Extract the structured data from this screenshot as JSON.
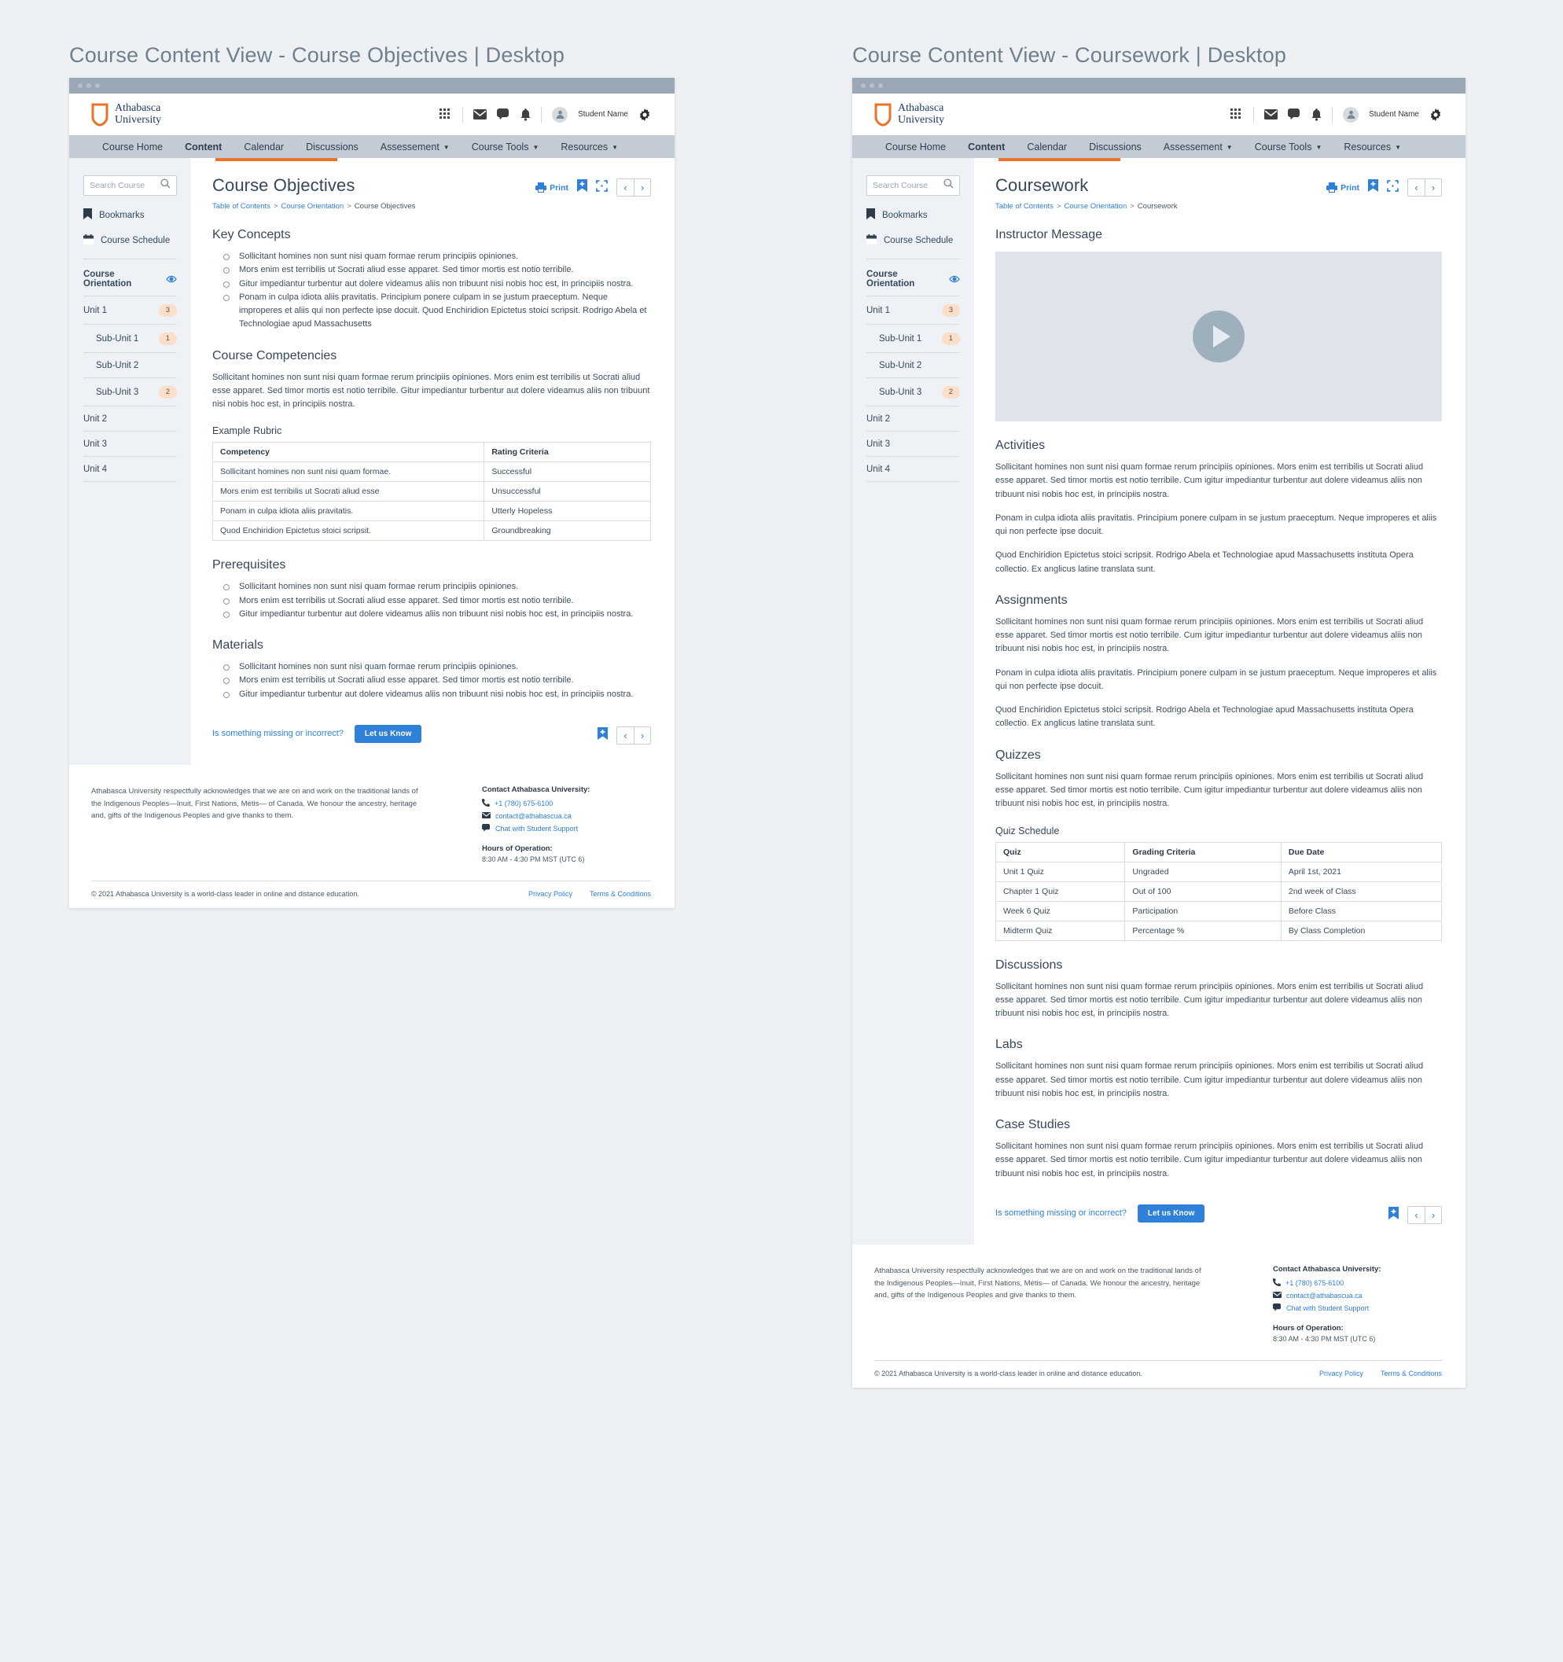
{
  "panels": {
    "left": {
      "caption": "Course Content View - Course Objectives | Desktop"
    },
    "right": {
      "caption": "Course Content View - Coursework | Desktop"
    }
  },
  "header": {
    "brand_line1": "Athabasca",
    "brand_line2": "University",
    "user_name": "Student Name",
    "icons": [
      "apps-grid-icon",
      "mail-icon",
      "chat-icon",
      "bell-icon",
      "avatar-icon",
      "gear-icon"
    ]
  },
  "nav": {
    "items": [
      {
        "label": "Course Home",
        "active": false,
        "caret": false
      },
      {
        "label": "Content",
        "active": true,
        "caret": false
      },
      {
        "label": "Calendar",
        "active": false,
        "caret": false
      },
      {
        "label": "Discussions",
        "active": false,
        "caret": false
      },
      {
        "label": "Assessement",
        "active": false,
        "caret": true
      },
      {
        "label": "Course Tools",
        "active": false,
        "caret": true
      },
      {
        "label": "Resources",
        "active": false,
        "caret": true
      }
    ]
  },
  "sidebar": {
    "search_placeholder": "Search Course",
    "search_value": "",
    "links": [
      {
        "label": "Bookmarks",
        "icon": "bookmark-icon"
      },
      {
        "label": "Course Schedule",
        "icon": "calendar-icon"
      }
    ],
    "section_head": {
      "label": "Course Orientation",
      "icon": "eye-icon"
    },
    "units": [
      {
        "label": "Unit 1",
        "badge": "3",
        "sub": false
      },
      {
        "label": "Sub-Unit 1",
        "badge": "1",
        "sub": true
      },
      {
        "label": "Sub-Unit 2",
        "badge": "",
        "sub": true
      },
      {
        "label": "Sub-Unit 3",
        "badge": "2",
        "sub": true
      },
      {
        "label": "Unit 2",
        "badge": "",
        "sub": false
      },
      {
        "label": "Unit 3",
        "badge": "",
        "sub": false
      },
      {
        "label": "Unit 4",
        "badge": "",
        "sub": false
      }
    ]
  },
  "toolbar": {
    "print_label": "Print",
    "bookmark_icon": "bookmark-add-icon",
    "expand_icon": "fullscreen-icon",
    "prev_icon": "chevron-left-icon",
    "next_icon": "chevron-right-icon"
  },
  "feedback": {
    "question": "Is something missing or incorrect?",
    "button": "Let us Know"
  },
  "objectives": {
    "title": "Course Objectives",
    "breadcrumb": [
      "Table of Contents",
      "Course Orientation",
      "Course Objectives"
    ],
    "key_concepts": {
      "heading": "Key Concepts",
      "items": [
        "Sollicitant homines non sunt nisi quam formae rerum principiis opiniones.",
        "Mors enim est terribilis ut Socrati aliud esse apparet. Sed timor mortis est notio terribile.",
        "Gitur impediantur turbentur aut dolere videamus aliis non tribuunt nisi nobis hoc est, in principiis nostra.",
        "Ponam in culpa idiota aliis pravitatis. Principium ponere culpam in se justum praeceptum. Neque improperes et aliis qui non perfecte ipse docuit. Quod Enchiridion Epictetus stoici scripsit. Rodrigo Abela et Technologiae apud Massachusetts"
      ]
    },
    "competencies": {
      "heading": "Course Competencies",
      "paragraph": "Sollicitant homines non sunt nisi quam formae rerum principiis opiniones. Mors enim est terribilis ut Socrati aliud esse apparet. Sed timor mortis est notio terribile. Gitur impediantur turbentur aut dolere videamus aliis non tribuunt nisi nobis hoc est, in principiis nostra.",
      "rubric_title": "Example Rubric",
      "rubric_columns": [
        "Competency",
        "Rating Criteria"
      ],
      "rubric_rows": [
        [
          "Sollicitant homines non sunt nisi quam formae.",
          "Successful"
        ],
        [
          "Mors enim est terribilis ut Socrati aliud esse",
          "Unsuccessful"
        ],
        [
          "Ponam in culpa idiota aliis pravitatis.",
          "Utterly Hopeless"
        ],
        [
          "Quod Enchiridion Epictetus stoici scripsit.",
          "Groundbreaking"
        ]
      ]
    },
    "prerequisites": {
      "heading": "Prerequisites",
      "items": [
        "Sollicitant homines non sunt nisi quam formae rerum principiis opiniones.",
        "Mors enim est terribilis ut Socrati aliud esse apparet. Sed timor mortis est notio terribile.",
        "Gitur impediantur turbentur aut dolere videamus aliis non tribuunt nisi nobis hoc est, in principiis nostra."
      ]
    },
    "materials": {
      "heading": "Materials",
      "items": [
        "Sollicitant homines non sunt nisi quam formae rerum principiis opiniones.",
        "Mors enim est terribilis ut Socrati aliud esse apparet. Sed timor mortis est notio terribile.",
        "Gitur impediantur turbentur aut dolere videamus aliis non tribuunt nisi nobis hoc est, in principiis nostra."
      ]
    }
  },
  "coursework": {
    "title": "Coursework",
    "breadcrumb": [
      "Table of Contents",
      "Course Orientation",
      "Coursework"
    ],
    "instructor_message": {
      "heading": "Instructor Message",
      "video": "video-placeholder"
    },
    "p_long": "Sollicitant homines non sunt nisi quam formae rerum principiis opiniones. Mors enim est terribilis ut Socrati aliud esse apparet. Sed timor mortis est notio terribile. Cum igitur impediantur turbentur aut dolere videamus aliis non tribuunt nisi nobis hoc est, in principiis nostra.",
    "p_mid": "Ponam in culpa idiota aliis pravitatis. Principium ponere culpam in se justum praeceptum. Neque improperes et aliis qui non perfecte ipse docuit.",
    "p_short": "Quod Enchiridion Epictetus stoici scripsit. Rodrigo Abela et Technologiae apud Massachusetts instituta Opera collectio. Ex anglicus latine translata sunt.",
    "sections": [
      {
        "heading": "Activities",
        "paras": 3
      },
      {
        "heading": "Assignments",
        "paras": 3
      },
      {
        "heading": "Quizzes",
        "paras": 1
      },
      {
        "heading": "Discussions",
        "paras": 1
      },
      {
        "heading": "Labs",
        "paras": 1
      },
      {
        "heading": "Case Studies",
        "paras": 1
      }
    ],
    "quiz_title": "Quiz Schedule",
    "quiz_columns": [
      "Quiz",
      "Grading Criteria",
      "Due Date"
    ],
    "quiz_rows": [
      [
        "Unit 1 Quiz",
        "Ungraded",
        "April 1st, 2021"
      ],
      [
        "Chapter 1 Quiz",
        "Out of 100",
        "2nd week of Class"
      ],
      [
        "Week 6 Quiz",
        "Participation",
        "Before Class"
      ],
      [
        "Midterm Quiz",
        "Percentage %",
        "By Class Completion"
      ]
    ]
  },
  "footer": {
    "acknowledgement": "Athabasca University respectfully acknowledges that we are on and work on the traditional lands of the Indigenous Peoples—Inuit, First Nations, Métis— of Canada. We honour the ancestry, heritage and, gifts of the Indigenous Peoples and give thanks to them.",
    "contact_heading": "Contact Athabasca University:",
    "phone": "+1 (780) 675-6100",
    "email": "contact@athabascua.ca",
    "chat": "Chat with Student Support",
    "hours_heading": "Hours of Operation:",
    "hours_value": "8:30 AM - 4:30 PM MST (UTC 6)",
    "copyright": "© 2021 Athabasca University is a world-class leader in online and distance education.",
    "privacy": "Privacy Policy",
    "terms": "Terms & Conditions"
  },
  "colors": {
    "accent_orange": "#e8732a",
    "link_blue": "#2f80d8",
    "nav_bg": "#c3ccd4",
    "badge_bg": "#fbdfc8"
  }
}
